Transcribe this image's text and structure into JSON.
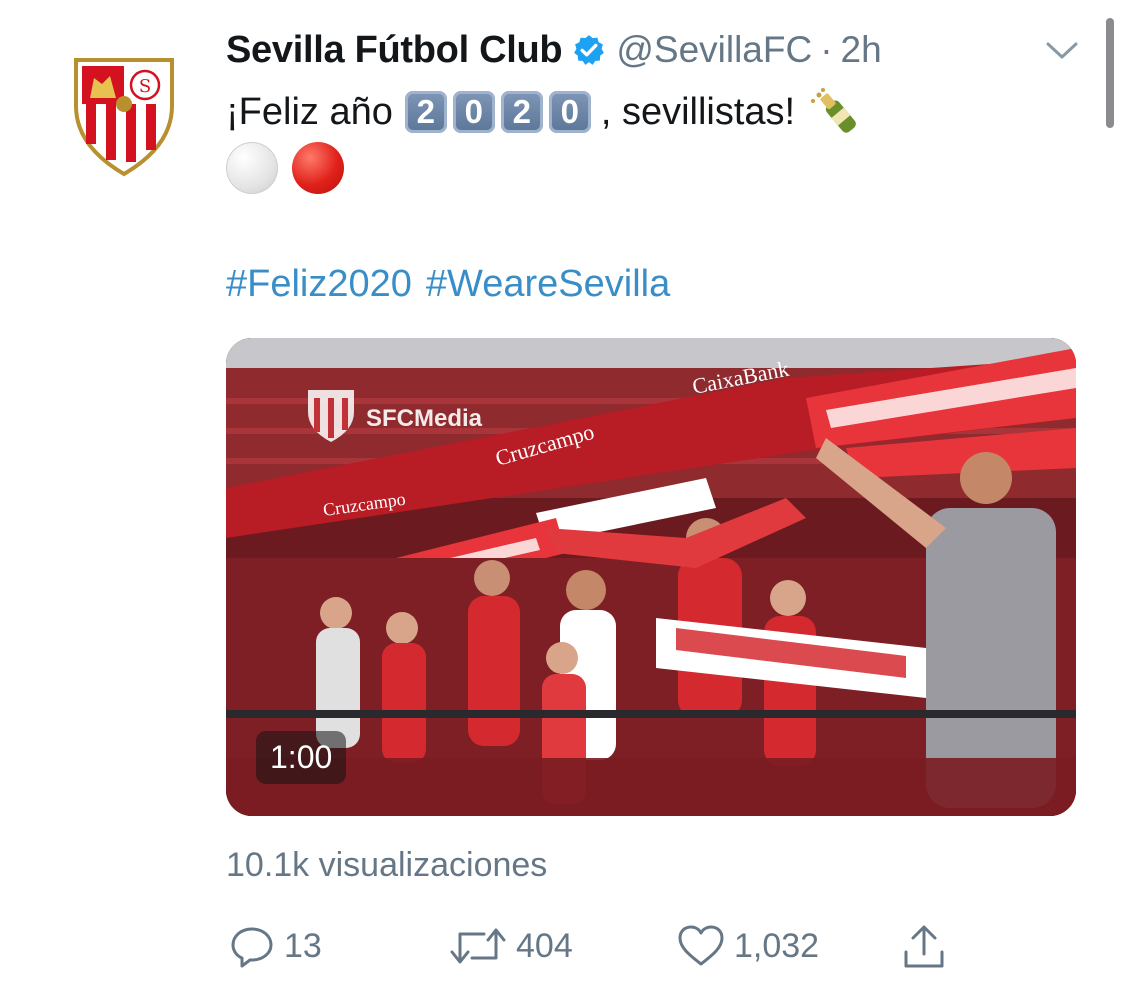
{
  "tweet": {
    "author_name": "Sevilla Fútbol Club",
    "handle": "@SevillaFC",
    "separator": "·",
    "time": "2h",
    "text_prefix": "¡Feliz año",
    "year_digits": [
      "2",
      "0",
      "2",
      "0"
    ],
    "text_suffix": ", sevillistas!",
    "hashtags": [
      "#Feliz2020",
      "#WeareSevilla"
    ]
  },
  "media": {
    "duration": "1:00",
    "overlay_logo_text": "SFCMedia",
    "sponsor_texts": [
      "CaixaBank",
      "Cruzcampo",
      "Cruzcampo"
    ]
  },
  "stats": {
    "views": "10.1k visualizaciones",
    "replies": "13",
    "retweets": "404",
    "likes": "1,032"
  },
  "colors": {
    "link": "#3a8ec8",
    "muted": "#657786",
    "verified": "#1da1f2",
    "club_red": "#d4111f"
  },
  "icons": {
    "verified": "verified-badge-icon",
    "menu": "chevron-down-icon",
    "champagne": "champagne-icon",
    "reply": "reply-icon",
    "retweet": "retweet-icon",
    "like": "heart-icon",
    "share": "share-icon"
  }
}
